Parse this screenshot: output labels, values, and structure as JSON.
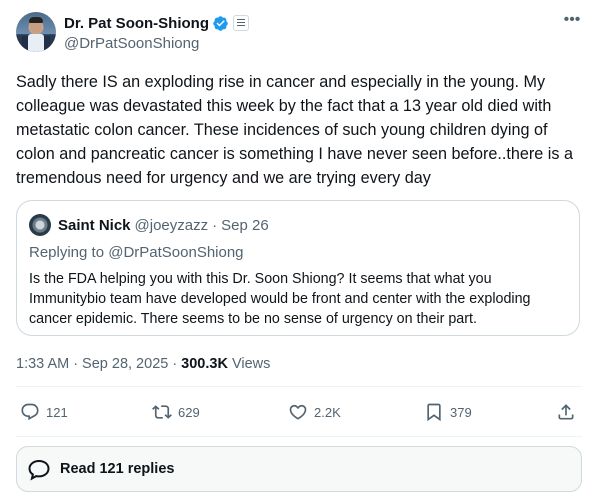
{
  "author": {
    "name": "Dr. Pat Soon-Shiong",
    "handle": "@DrPatSoonShiong",
    "verified_color": "#1d9bf0"
  },
  "tweet": {
    "text": "Sadly there IS an exploding rise in cancer and especially in the young. My colleague was devastated this week by the fact that a 13 year old died with metastatic colon cancer. These incidences of such young children dying of colon and pancreatic cancer is something I have never seen before..there is a tremendous need for urgency and we are trying every day"
  },
  "quoted": {
    "name": "Saint Nick",
    "handle": "@joeyzazz",
    "separator": "·",
    "date": "Sep 26",
    "replying_to": "Replying to @DrPatSoonShiong",
    "text": "Is the FDA helping you with this Dr. Soon Shiong? It seems that what you Immunitybio team have developed would be front and center with the exploding cancer epidemic. There seems to be no sense of urgency on their part."
  },
  "meta": {
    "time": "1:33 AM",
    "sep1": "·",
    "date": "Sep 28, 2025",
    "sep2": "·",
    "views": "300.3K",
    "views_label": "Views"
  },
  "actions": {
    "replies": "121",
    "reposts": "629",
    "likes": "2.2K",
    "bookmarks": "379"
  },
  "read_replies": {
    "label": "Read 121 replies"
  },
  "colors": {
    "text": "#0f1419",
    "secondary": "#536471",
    "border": "#cfd9de",
    "accent": "#1d9bf0"
  }
}
